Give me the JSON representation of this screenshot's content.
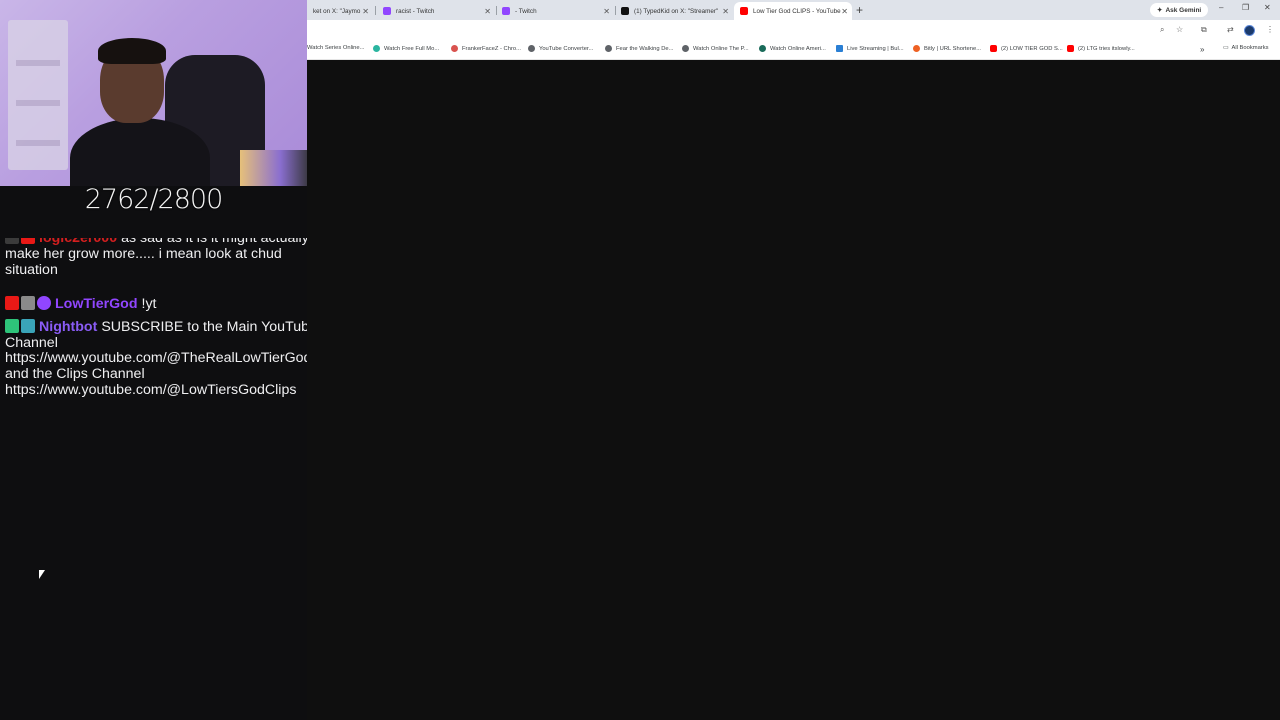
{
  "stream": {
    "counter": "2762/2800"
  },
  "chat": {
    "messages": [
      {
        "user": "logic2er000",
        "text": "as sad as it is it might actually make her grow more..... i mean look at chud situation",
        "user_color": "#d41f1f"
      },
      {
        "user": "LowTierGod",
        "text": "!yt",
        "user_color": "#9146ff"
      },
      {
        "user": "Nightbot",
        "text": "SUBSCRIBE to the Main YouTube Channel https://www.youtube.com/@TheRealLowTierGod and the Clips Channel https://www.youtube.com/@LowTiersGodClips",
        "user_color": "#8a5cf6"
      }
    ]
  },
  "browser": {
    "tabs": [
      {
        "label": "ket on X: \"Jaymo",
        "icon": "x-icon"
      },
      {
        "label": "racist - Twitch",
        "icon": "twitch-icon"
      },
      {
        "label": "- Twitch",
        "icon": "twitch-icon"
      },
      {
        "label": "(1) TypedKid on X: \"Streamer\"",
        "icon": "x-icon"
      },
      {
        "label": "Low Tier God CLIPS - YouTube",
        "icon": "youtube-icon",
        "active": true
      }
    ],
    "ask_gemini": "Ask Gemini",
    "bookmarks": [
      "Watch Series Online...",
      "Watch Free Full Mo...",
      "FrankerFaceZ - Chro...",
      "YouTube Converter...",
      "Fear the Walking De...",
      "Watch Online The P...",
      "Watch Online Ameri...",
      "Live Streaming | Bul...",
      "Bitly | URL Shortene...",
      "(2) LOW TIER GOD S...",
      "(2) LTG tries itslowly..."
    ],
    "all_bookmarks": "All Bookmarks"
  },
  "colors": {
    "page_bg": "#0e0e10",
    "chrome_bg": "#dfe3ea",
    "cam_bg": "#b99fe0"
  }
}
